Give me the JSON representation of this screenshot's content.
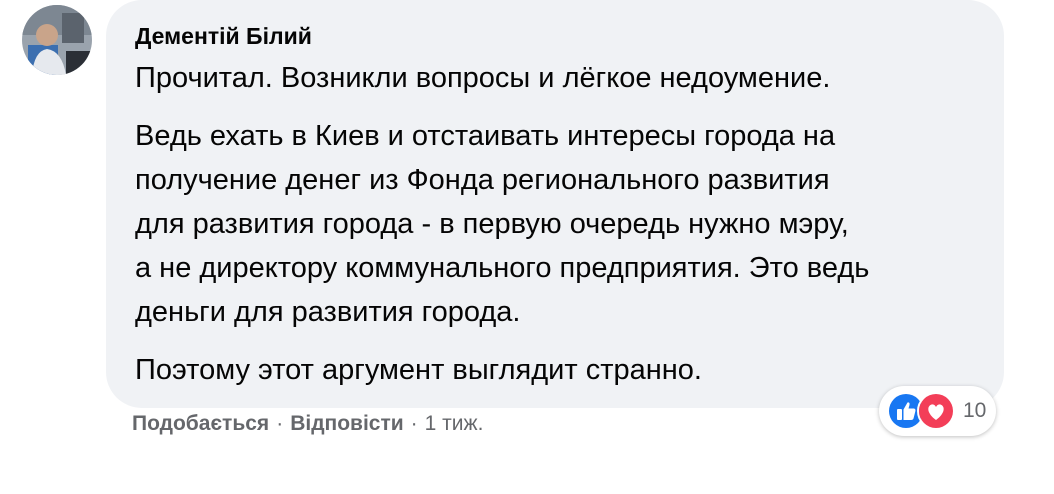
{
  "comment": {
    "author": "Дементій Білий",
    "paragraphs": [
      "Прочитал. Возникли вопросы и лёгкое недоумение.",
      "Ведь ехать в Киев и отстаивать интересы города на\nполучение денег из Фонда регионального развития\nдля развития города - в первую очередь нужно мэру,\nа не директору коммунального предприятия. Это ведь\nденьги для развития города.",
      "Поэтому этот аргумент выглядит странно."
    ]
  },
  "actions": {
    "like_label": "Подобається",
    "reply_label": "Відповісти",
    "separator": "·",
    "time": "1 тиж."
  },
  "reactions": {
    "icons": [
      "like-icon",
      "love-icon"
    ],
    "count": "10",
    "like_color": "#1877f2",
    "love_color": "#f33e58"
  },
  "colors": {
    "bubble_bg": "#f0f2f5",
    "secondary_text": "#65676b"
  }
}
